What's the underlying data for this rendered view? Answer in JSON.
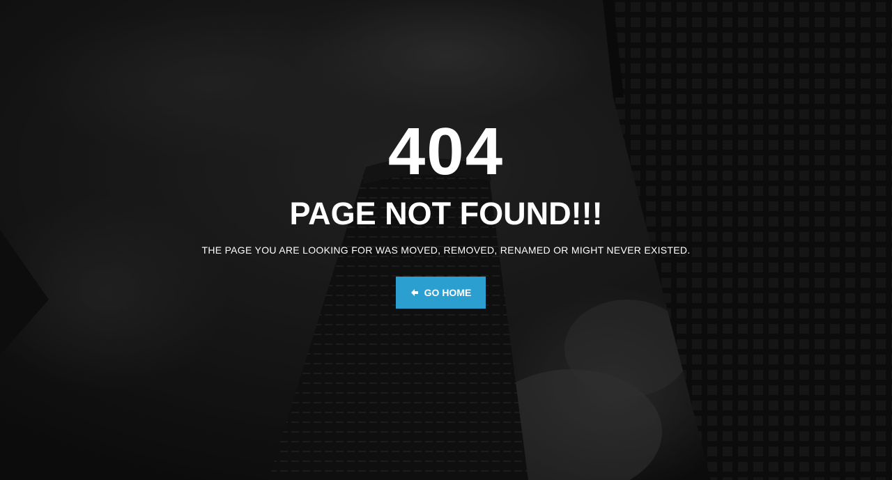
{
  "error": {
    "code": "404",
    "title": "PAGE NOT FOUND!!!",
    "message": "THE PAGE YOU ARE LOOKING FOR WAS MOVED, REMOVED, RENAMED OR MIGHT NEVER EXISTED."
  },
  "button": {
    "label": "GO HOME",
    "icon": "arrow-left-icon",
    "color": "#2ba0d0"
  },
  "background": {
    "description_color": "#151515"
  }
}
